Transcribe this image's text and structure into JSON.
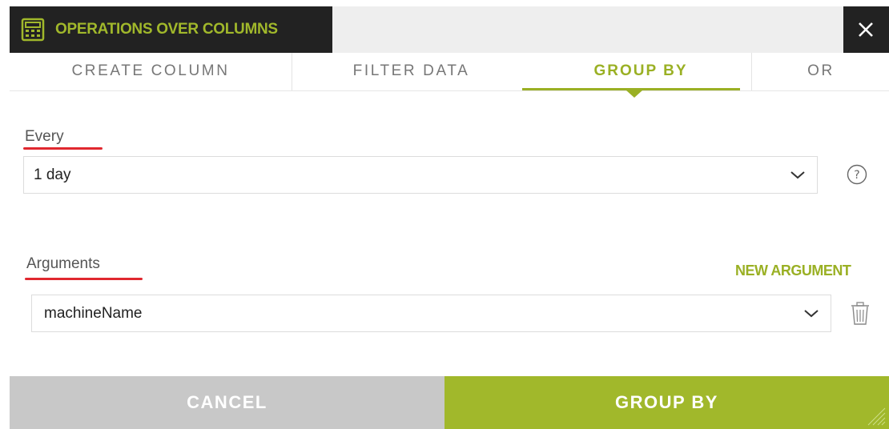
{
  "dialog": {
    "title": "OPERATIONS OVER COLUMNS",
    "title_icon": "calculator-icon",
    "close_icon": "close-icon"
  },
  "tabs": [
    {
      "label": "CREATE COLUMN",
      "active": false
    },
    {
      "label": "FILTER DATA",
      "active": false
    },
    {
      "label": "GROUP BY",
      "active": true
    },
    {
      "label": "OR",
      "active": false
    }
  ],
  "every": {
    "label": "Every",
    "value": "1 day",
    "help_icon": "question-circle-icon"
  },
  "arguments": {
    "label": "Arguments",
    "new_argument_label": "NEW ARGUMENT",
    "items": [
      {
        "value": "machineName",
        "delete_icon": "trash-icon"
      }
    ]
  },
  "footer": {
    "cancel_label": "CANCEL",
    "submit_label": "GROUP BY"
  },
  "colors": {
    "accent": "#a1b82b",
    "title_bar": "#222222",
    "cancel_bg": "#c8c8c8",
    "annotation_underline": "#e0282f"
  }
}
